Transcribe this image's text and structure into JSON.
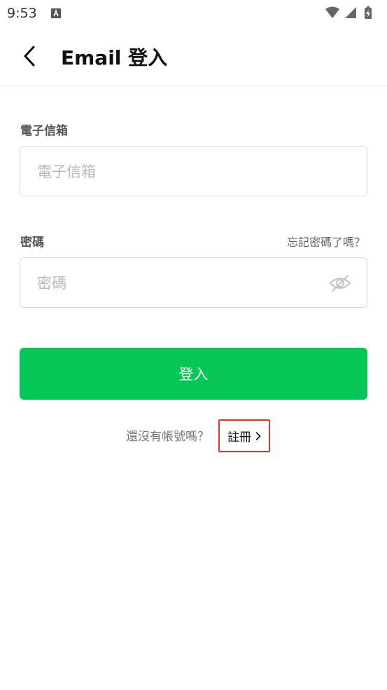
{
  "status_bar": {
    "time": "9:53",
    "icons": [
      "a-notification-icon",
      "wifi-icon",
      "cellular-signal-icon",
      "battery-charging-icon"
    ]
  },
  "header": {
    "back_icon": "chevron-left-icon",
    "title": "Email 登入"
  },
  "form": {
    "email_label": "電子信箱",
    "email_placeholder": "電子信箱",
    "email_value": "",
    "password_label": "密碼",
    "forgot_password": "忘記密碼了嗎？",
    "password_placeholder": "密碼",
    "password_value": "",
    "password_toggle_icon": "eye-off-icon",
    "login_button": "登入"
  },
  "register": {
    "prompt": "還沒有帳號嗎？",
    "link_label": "註冊",
    "link_icon": "chevron-right-icon"
  },
  "colors": {
    "primary_green": "#06c755",
    "highlight_border": "#e0332e"
  }
}
